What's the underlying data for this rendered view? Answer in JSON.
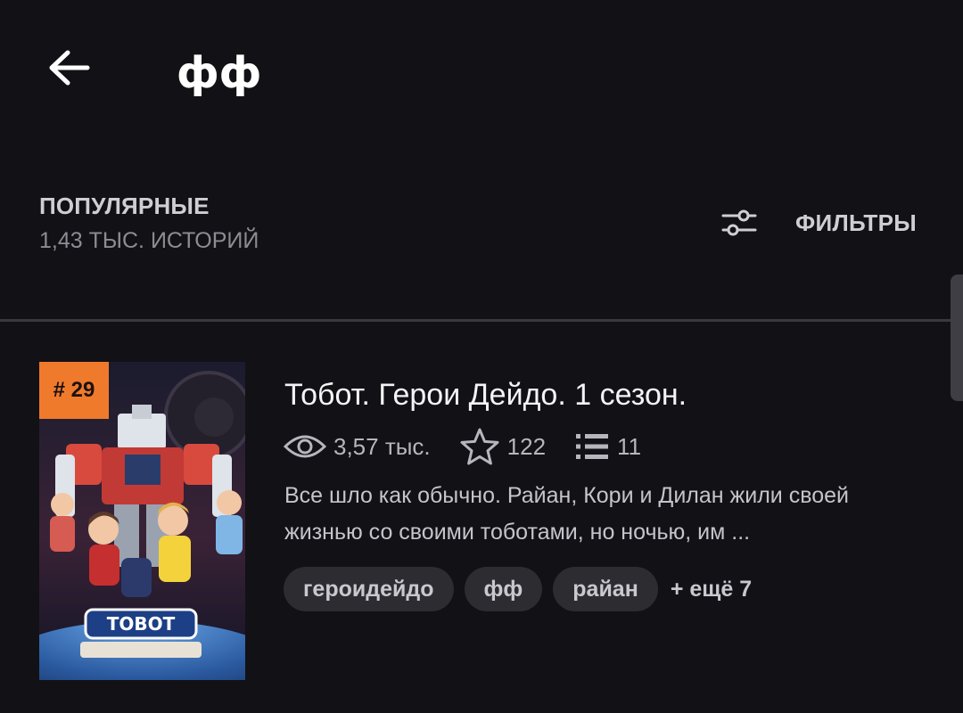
{
  "header": {
    "title": "фф",
    "back_icon": "arrow-left-icon"
  },
  "section": {
    "sort_label": "ПОПУЛЯРНЫЕ",
    "count_label": "1,43 ТЫС. ИСТОРИЙ",
    "filters_label": "ФИЛЬТРЫ",
    "filters_icon": "sliders-icon"
  },
  "story": {
    "rank": "# 29",
    "title": "Тобот. Герои Дейдо. 1 сезон.",
    "reads": "3,57 тыс.",
    "votes": "122",
    "parts": "11",
    "description": "Все шло как обычно. Райан, Кори и Дилан жили своей жизнью со своими тоботами, но ночью, им ...",
    "tags": [
      "героидейдо",
      "фф",
      "райан"
    ],
    "more_tags": "+ ещё 7",
    "cover_logo": "TOBOT",
    "icons": {
      "reads": "eye-icon",
      "votes": "star-icon",
      "parts": "list-icon"
    }
  },
  "colors": {
    "background": "#121115",
    "rank_badge": "#f07a2c",
    "tag_bg": "#2d2c31",
    "muted_text": "#8d8c93"
  }
}
